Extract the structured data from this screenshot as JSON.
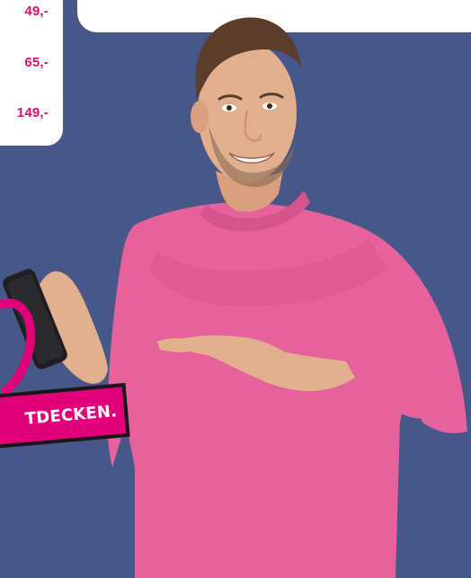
{
  "prices": [
    {
      "label": "49,-"
    },
    {
      "label": "65,-"
    },
    {
      "label": "149,-"
    }
  ],
  "cta": {
    "label": "TDECKEN."
  },
  "colors": {
    "background": "#475788",
    "accent": "#e2007a",
    "shirt": "#e5629c"
  }
}
